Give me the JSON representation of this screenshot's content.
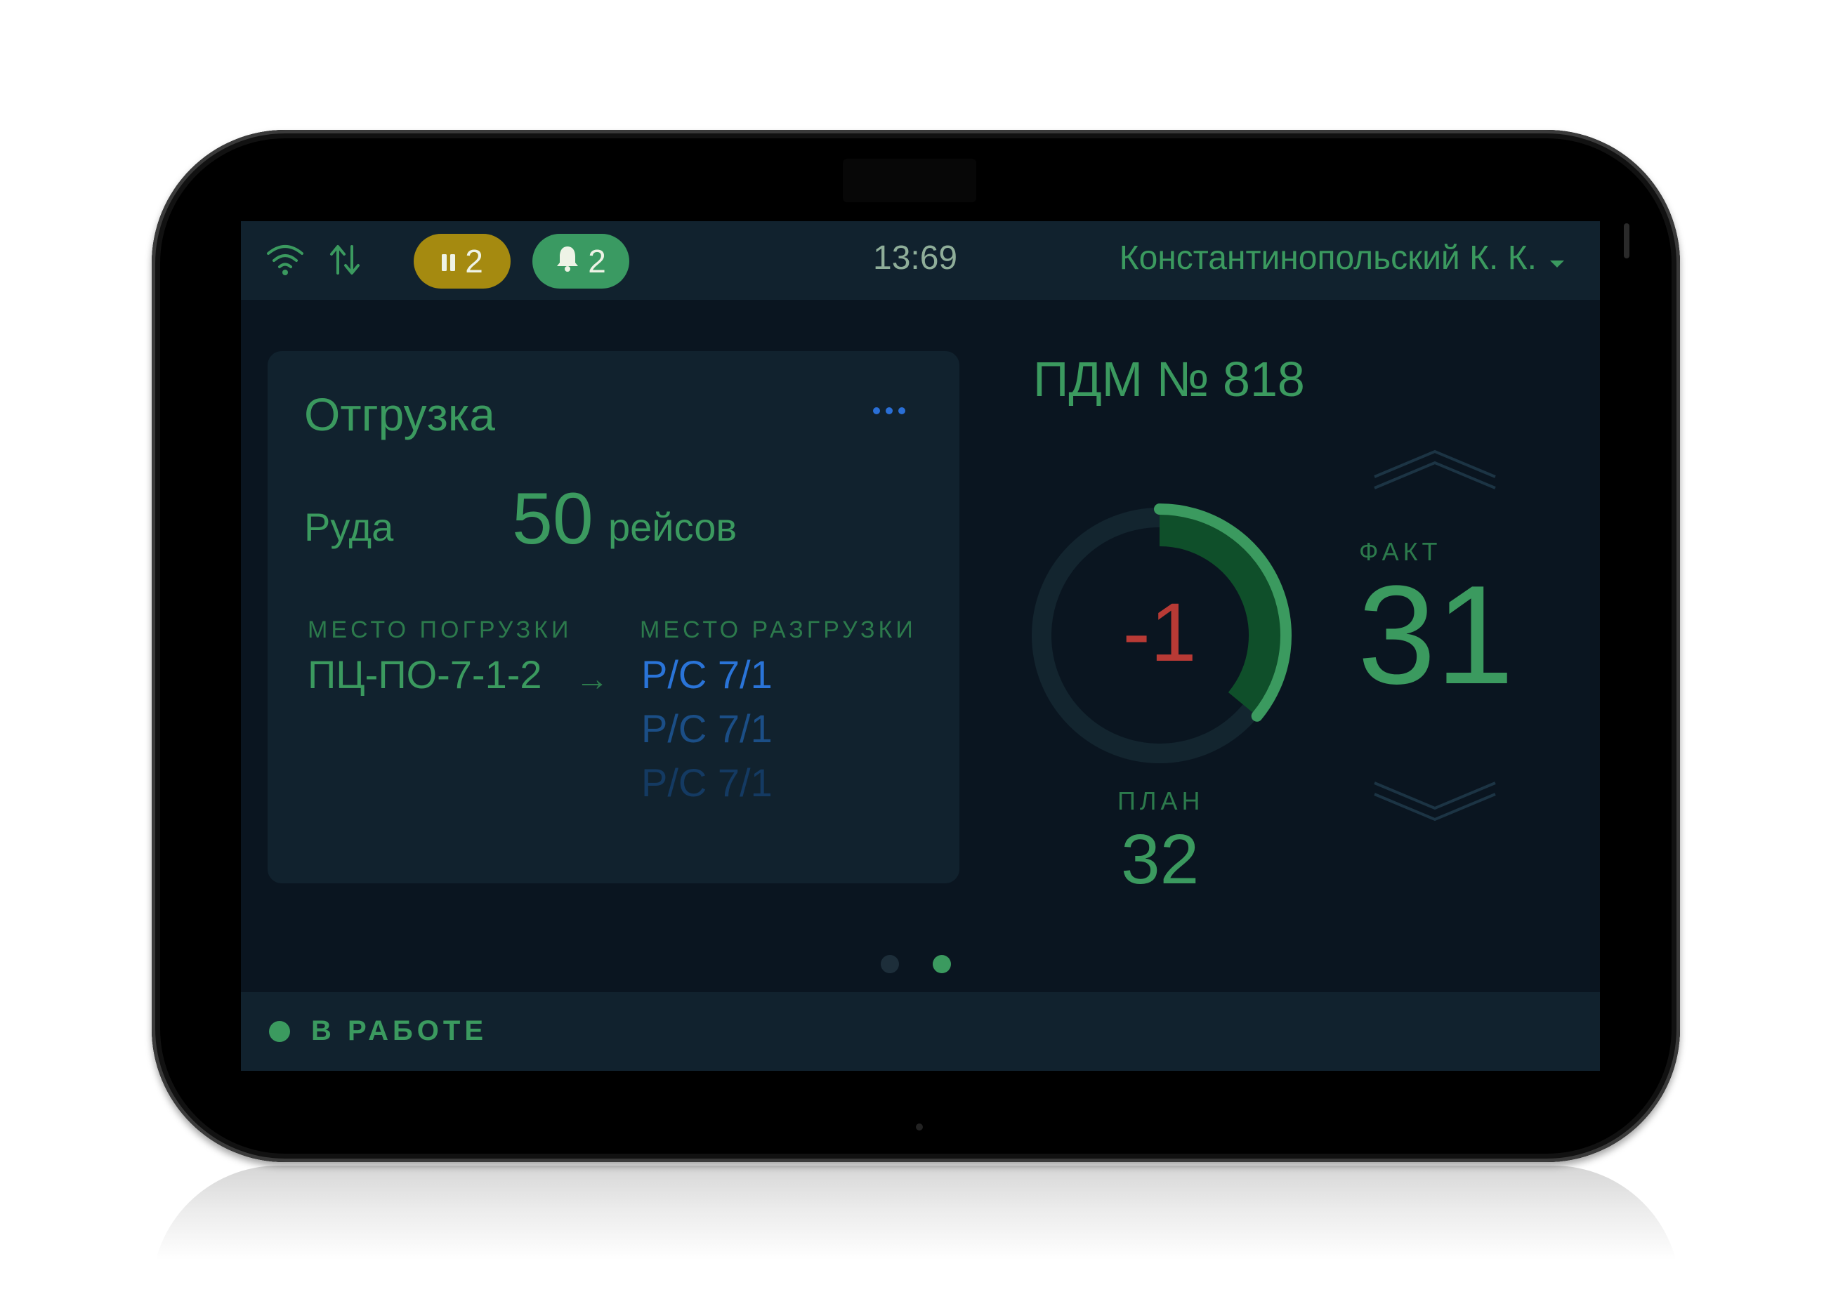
{
  "statusbar": {
    "wifi_icon": "wifi-icon",
    "sync_icon": "sync-arrows-icon",
    "paused_count": "2",
    "alerts_count": "2",
    "time": "13:69",
    "user_name": "Константинопольский К. К."
  },
  "task": {
    "title": "Отгрузка",
    "cargo": "Руда",
    "trips": "50",
    "trips_unit": "рейсов",
    "load_label": "МЕСТО ПОГРУЗКИ",
    "load_place": "ПЦ-ПО-7-1-2",
    "unload_label": "МЕСТО РАЗГРУЗКИ",
    "unload_places": [
      "Р/С 7/1",
      "Р/С 7/1",
      "Р/С 7/1"
    ]
  },
  "vehicle": {
    "title": "ПДМ № 818",
    "difference": "-1",
    "plan_label": "ПЛАН",
    "plan": "32",
    "fact_label": "ФАКТ",
    "fact": "31",
    "progress_fraction": 0.36
  },
  "pager": {
    "pages": 2,
    "active": 1
  },
  "status": {
    "text": "В РАБОТЕ"
  },
  "colors": {
    "accent": "#3b9a5f",
    "warning": "#a58a10",
    "negative": "#b83a35",
    "link": "#2a74d8",
    "background": "#0a1520",
    "panel": "#11222e"
  }
}
